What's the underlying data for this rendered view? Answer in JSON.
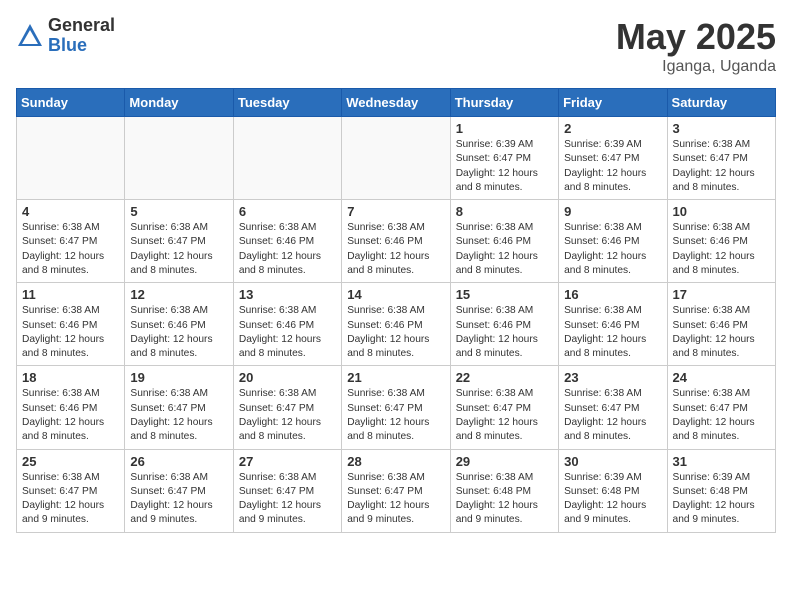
{
  "header": {
    "logo_general": "General",
    "logo_blue": "Blue",
    "title": "May 2025",
    "location": "Iganga, Uganda"
  },
  "days_of_week": [
    "Sunday",
    "Monday",
    "Tuesday",
    "Wednesday",
    "Thursday",
    "Friday",
    "Saturday"
  ],
  "weeks": [
    [
      {
        "num": "",
        "info": ""
      },
      {
        "num": "",
        "info": ""
      },
      {
        "num": "",
        "info": ""
      },
      {
        "num": "",
        "info": ""
      },
      {
        "num": "1",
        "info": "Sunrise: 6:39 AM\nSunset: 6:47 PM\nDaylight: 12 hours\nand 8 minutes."
      },
      {
        "num": "2",
        "info": "Sunrise: 6:39 AM\nSunset: 6:47 PM\nDaylight: 12 hours\nand 8 minutes."
      },
      {
        "num": "3",
        "info": "Sunrise: 6:38 AM\nSunset: 6:47 PM\nDaylight: 12 hours\nand 8 minutes."
      }
    ],
    [
      {
        "num": "4",
        "info": "Sunrise: 6:38 AM\nSunset: 6:47 PM\nDaylight: 12 hours\nand 8 minutes."
      },
      {
        "num": "5",
        "info": "Sunrise: 6:38 AM\nSunset: 6:47 PM\nDaylight: 12 hours\nand 8 minutes."
      },
      {
        "num": "6",
        "info": "Sunrise: 6:38 AM\nSunset: 6:46 PM\nDaylight: 12 hours\nand 8 minutes."
      },
      {
        "num": "7",
        "info": "Sunrise: 6:38 AM\nSunset: 6:46 PM\nDaylight: 12 hours\nand 8 minutes."
      },
      {
        "num": "8",
        "info": "Sunrise: 6:38 AM\nSunset: 6:46 PM\nDaylight: 12 hours\nand 8 minutes."
      },
      {
        "num": "9",
        "info": "Sunrise: 6:38 AM\nSunset: 6:46 PM\nDaylight: 12 hours\nand 8 minutes."
      },
      {
        "num": "10",
        "info": "Sunrise: 6:38 AM\nSunset: 6:46 PM\nDaylight: 12 hours\nand 8 minutes."
      }
    ],
    [
      {
        "num": "11",
        "info": "Sunrise: 6:38 AM\nSunset: 6:46 PM\nDaylight: 12 hours\nand 8 minutes."
      },
      {
        "num": "12",
        "info": "Sunrise: 6:38 AM\nSunset: 6:46 PM\nDaylight: 12 hours\nand 8 minutes."
      },
      {
        "num": "13",
        "info": "Sunrise: 6:38 AM\nSunset: 6:46 PM\nDaylight: 12 hours\nand 8 minutes."
      },
      {
        "num": "14",
        "info": "Sunrise: 6:38 AM\nSunset: 6:46 PM\nDaylight: 12 hours\nand 8 minutes."
      },
      {
        "num": "15",
        "info": "Sunrise: 6:38 AM\nSunset: 6:46 PM\nDaylight: 12 hours\nand 8 minutes."
      },
      {
        "num": "16",
        "info": "Sunrise: 6:38 AM\nSunset: 6:46 PM\nDaylight: 12 hours\nand 8 minutes."
      },
      {
        "num": "17",
        "info": "Sunrise: 6:38 AM\nSunset: 6:46 PM\nDaylight: 12 hours\nand 8 minutes."
      }
    ],
    [
      {
        "num": "18",
        "info": "Sunrise: 6:38 AM\nSunset: 6:46 PM\nDaylight: 12 hours\nand 8 minutes."
      },
      {
        "num": "19",
        "info": "Sunrise: 6:38 AM\nSunset: 6:47 PM\nDaylight: 12 hours\nand 8 minutes."
      },
      {
        "num": "20",
        "info": "Sunrise: 6:38 AM\nSunset: 6:47 PM\nDaylight: 12 hours\nand 8 minutes."
      },
      {
        "num": "21",
        "info": "Sunrise: 6:38 AM\nSunset: 6:47 PM\nDaylight: 12 hours\nand 8 minutes."
      },
      {
        "num": "22",
        "info": "Sunrise: 6:38 AM\nSunset: 6:47 PM\nDaylight: 12 hours\nand 8 minutes."
      },
      {
        "num": "23",
        "info": "Sunrise: 6:38 AM\nSunset: 6:47 PM\nDaylight: 12 hours\nand 8 minutes."
      },
      {
        "num": "24",
        "info": "Sunrise: 6:38 AM\nSunset: 6:47 PM\nDaylight: 12 hours\nand 8 minutes."
      }
    ],
    [
      {
        "num": "25",
        "info": "Sunrise: 6:38 AM\nSunset: 6:47 PM\nDaylight: 12 hours\nand 9 minutes."
      },
      {
        "num": "26",
        "info": "Sunrise: 6:38 AM\nSunset: 6:47 PM\nDaylight: 12 hours\nand 9 minutes."
      },
      {
        "num": "27",
        "info": "Sunrise: 6:38 AM\nSunset: 6:47 PM\nDaylight: 12 hours\nand 9 minutes."
      },
      {
        "num": "28",
        "info": "Sunrise: 6:38 AM\nSunset: 6:47 PM\nDaylight: 12 hours\nand 9 minutes."
      },
      {
        "num": "29",
        "info": "Sunrise: 6:38 AM\nSunset: 6:48 PM\nDaylight: 12 hours\nand 9 minutes."
      },
      {
        "num": "30",
        "info": "Sunrise: 6:39 AM\nSunset: 6:48 PM\nDaylight: 12 hours\nand 9 minutes."
      },
      {
        "num": "31",
        "info": "Sunrise: 6:39 AM\nSunset: 6:48 PM\nDaylight: 12 hours\nand 9 minutes."
      }
    ]
  ]
}
